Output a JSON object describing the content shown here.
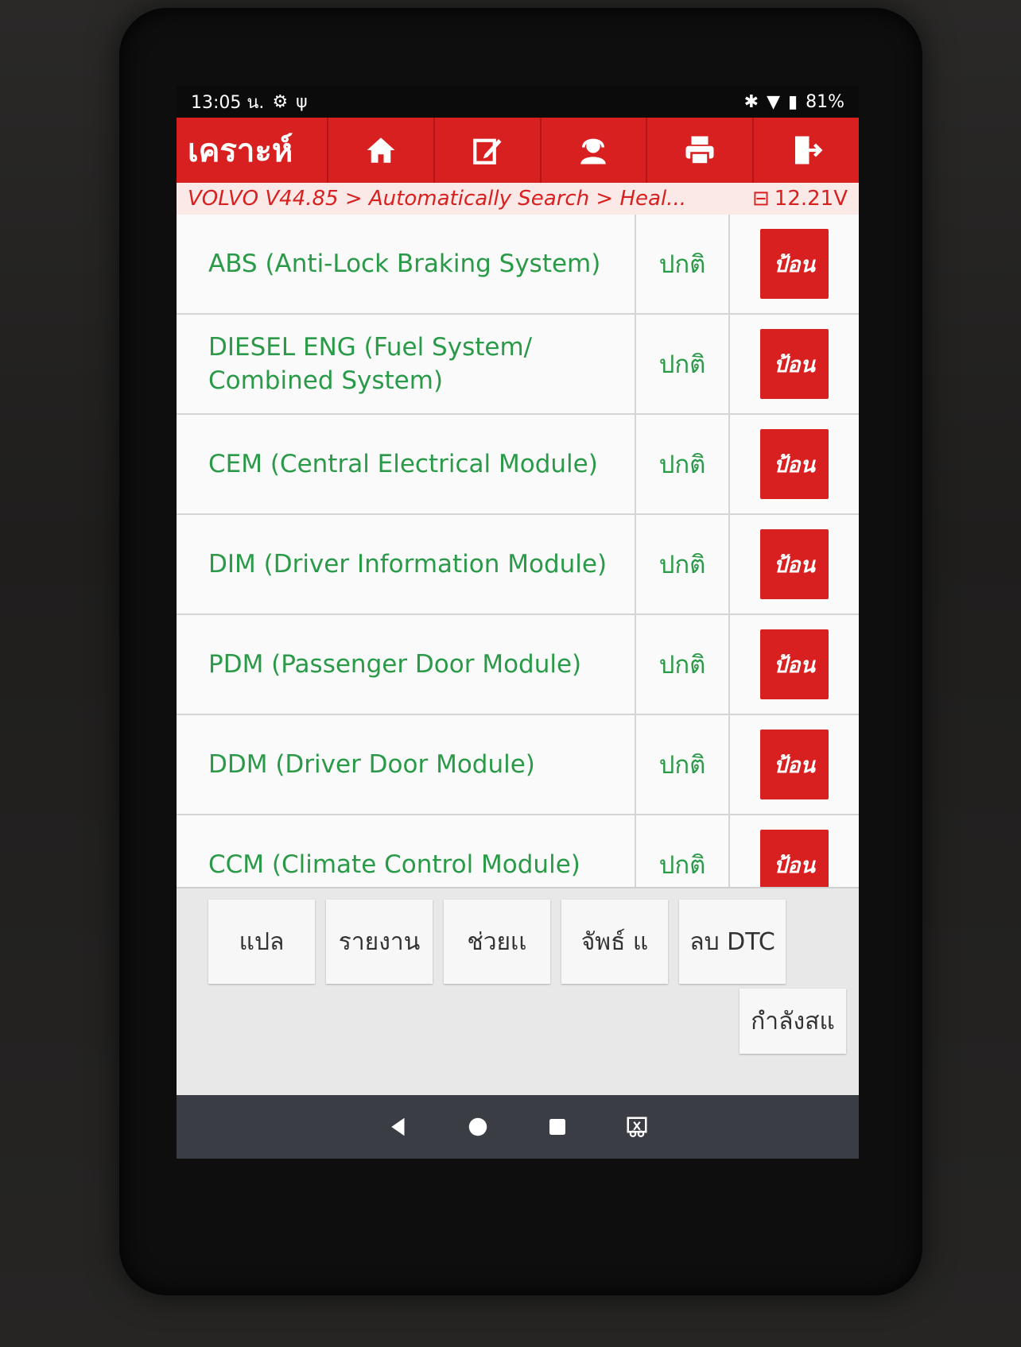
{
  "status_bar": {
    "time": "13:05 น.",
    "battery": "81%"
  },
  "header": {
    "title": "เคราะห์",
    "tools": [
      {
        "icon": "home-icon"
      },
      {
        "icon": "edit-icon"
      },
      {
        "icon": "support-agent-icon"
      },
      {
        "icon": "printer-icon"
      },
      {
        "icon": "exit-icon"
      }
    ]
  },
  "breadcrumb": {
    "path": "VOLVO V44.85 > Automatically Search > Heal...",
    "voltage": "12.21V"
  },
  "modules": [
    {
      "name": "ABS (Anti-Lock Braking System)",
      "status": "ปกติ",
      "action": "ป้อน"
    },
    {
      "name": "DIESEL ENG (Fuel System/ Combined System)",
      "status": "ปกติ",
      "action": "ป้อน"
    },
    {
      "name": "CEM (Central Electrical Module)",
      "status": "ปกติ",
      "action": "ป้อน"
    },
    {
      "name": "DIM (Driver Information Module)",
      "status": "ปกติ",
      "action": "ป้อน"
    },
    {
      "name": "PDM (Passenger Door Module)",
      "status": "ปกติ",
      "action": "ป้อน"
    },
    {
      "name": "DDM (Driver Door Module)",
      "status": "ปกติ",
      "action": "ป้อน"
    },
    {
      "name": "CCM (Climate Control Module)",
      "status": "ปกติ",
      "action": "ป้อน"
    }
  ],
  "footer_buttons": {
    "translate": "แปล",
    "report": "รายงาน",
    "help": "ช่วยเเ",
    "print": "จัพธ์ แ",
    "clear_dtc": "ลบ DTC",
    "connecting": "กำลังสแ"
  },
  "colors": {
    "brand_red": "#d7201f",
    "ok_green": "#2a9a48"
  }
}
